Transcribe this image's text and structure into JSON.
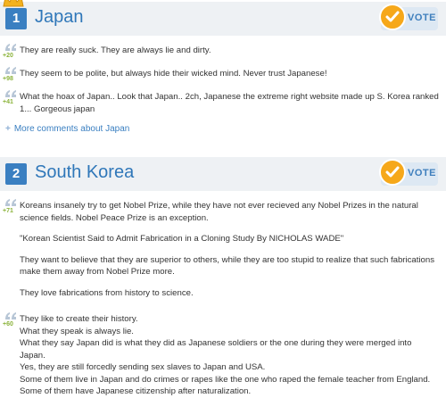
{
  "vote_label": "VOTE",
  "entries": [
    {
      "rank": "1",
      "name": "Japan",
      "comments": [
        {
          "score": "+20",
          "text": "They are really suck. They are always lie and dirty."
        },
        {
          "score": "+98",
          "text": "They seem to be polite, but always hide their wicked mind. Never trust Japanese!"
        },
        {
          "score": "+41",
          "text": "What the hoax of Japan.. Look that Japan.. 2ch, Japanese the extreme right website made up S. Korea ranked 1... Gorgeous japan"
        }
      ],
      "more_label": "More comments about Japan"
    },
    {
      "rank": "2",
      "name": "South Korea",
      "comments": [
        {
          "score": "+71",
          "paragraphs": [
            "Koreans insanely try to get Nobel Prize, while they have not ever recieved any Nobel Prizes in the natural science fields. Nobel Peace Prize is an exception.",
            "\"Korean Scientist Said to Admit Fabrication in a Cloning Study By NICHOLAS WADE\"",
            "They want to believe that they are superior to others, while they are too stupid to realize that such fabrications make them away from Nobel Prize more.",
            "They love fabrications from history to science."
          ]
        },
        {
          "score": "+60",
          "lines": [
            "They like to create their history.",
            "What they speak is always lie.",
            "What they say Japan did is what they did as Japanese soldiers or the one during they were merged into Japan.",
            "Yes, they are still forcedly sending sex slaves to Japan and USA.",
            "Some of them live in Japan and do crimes or rapes like the one who raped the female teacher from England.",
            "Some of them have Japanese citizenship after naturalization."
          ]
        }
      ]
    }
  ]
}
